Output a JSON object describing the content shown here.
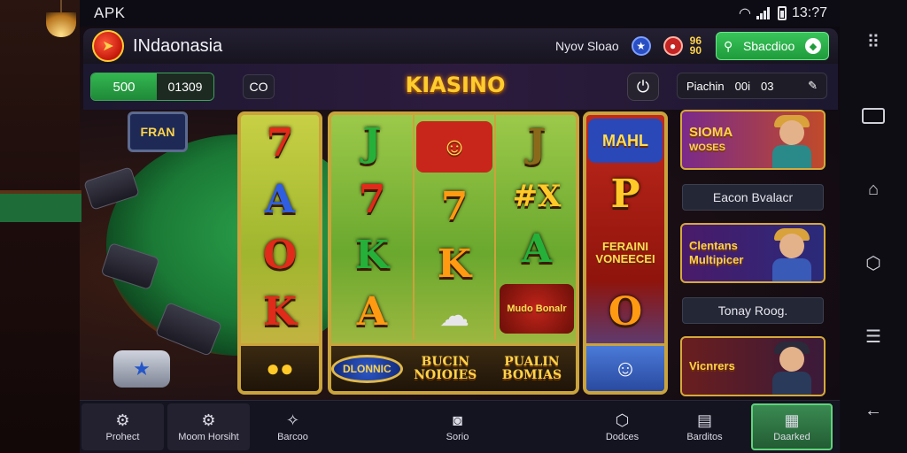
{
  "status_bar": {
    "app": "APK",
    "time": "13:?7"
  },
  "header": {
    "app_name": "INdaonasia",
    "link": "Nyov Sloao",
    "badge_top": "96",
    "badge_bottom": "90",
    "search_label": "Sbacdioo"
  },
  "subbar": {
    "balance_primary": "500",
    "balance_secondary": "01309",
    "pill": "CO",
    "title": "KIASINO",
    "stats": [
      "Piachin",
      "00i",
      "03"
    ]
  },
  "casino_sign": "FRAN",
  "reels": {
    "col1": [
      "7",
      "A",
      "O",
      "K"
    ],
    "col2": [
      "J",
      "7",
      "K",
      "A"
    ],
    "col3": [
      "7",
      "K"
    ],
    "col4": [
      "J",
      "#X",
      "A"
    ],
    "col5_top": "MAHL",
    "col5": [
      "P",
      "O"
    ],
    "mid_badge": "Mudo Bonalr",
    "side_banner": "FERAINI VONEECEI",
    "bottom": [
      "DLONNIC",
      "BUCIN NOIOIES",
      "PUALIN BOMIAS"
    ]
  },
  "promos": {
    "card1_title": "SIOMA",
    "card1_sub": "WOSES",
    "label1": "Eacon Bvalacr",
    "card2_title": "Clentans Multipicer",
    "label2": "Tonay Roog.",
    "card3_title": "Vicnrers"
  },
  "bottom_nav": [
    {
      "label": "Prohect",
      "icon": "gear-icon"
    },
    {
      "label": "Moom Horsiht",
      "icon": "gear-icon"
    },
    {
      "label": "Barcoo",
      "icon": "sparkle-icon"
    },
    {
      "label": "",
      "icon": ""
    },
    {
      "label": "Sorio",
      "icon": "camera-icon"
    },
    {
      "label": "",
      "icon": ""
    },
    {
      "label": "Dodces",
      "icon": "hexagon-icon"
    },
    {
      "label": "Barditos",
      "icon": "chest-icon"
    },
    {
      "label": "Daarked",
      "icon": "store-icon"
    }
  ],
  "colors": {
    "accent_green": "#2fae4c",
    "gold": "#ffcc2e",
    "frame_gold": "#caa33c"
  }
}
